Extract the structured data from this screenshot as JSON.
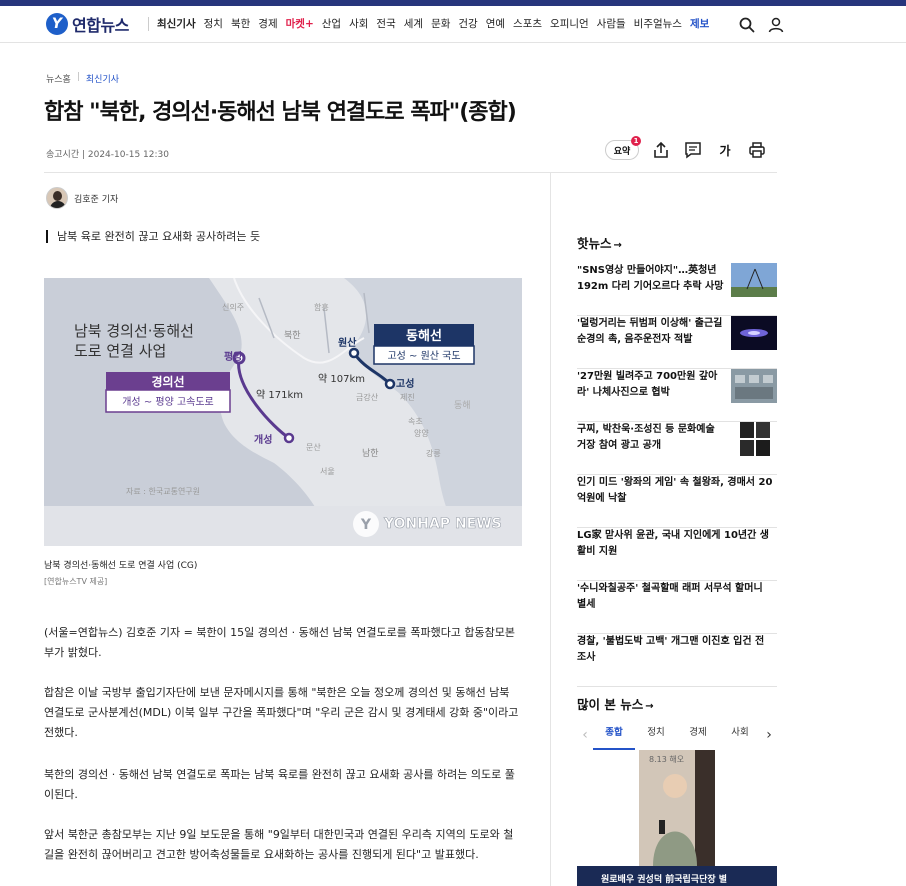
{
  "header": {
    "logo_text": "연합뉴스",
    "nav": [
      {
        "label": "최신기사",
        "style": "bold"
      },
      {
        "label": "정치",
        "style": ""
      },
      {
        "label": "북한",
        "style": ""
      },
      {
        "label": "경제",
        "style": ""
      },
      {
        "label": "마켓+",
        "style": "red"
      },
      {
        "label": "산업",
        "style": ""
      },
      {
        "label": "사회",
        "style": ""
      },
      {
        "label": "전국",
        "style": ""
      },
      {
        "label": "세계",
        "style": ""
      },
      {
        "label": "문화",
        "style": ""
      },
      {
        "label": "건강",
        "style": ""
      },
      {
        "label": "연예",
        "style": ""
      },
      {
        "label": "스포츠",
        "style": ""
      },
      {
        "label": "오피니언",
        "style": ""
      },
      {
        "label": "사람들",
        "style": ""
      },
      {
        "label": "비주얼뉴스",
        "style": ""
      },
      {
        "label": "제보",
        "style": "blue"
      }
    ],
    "icons": [
      "search-icon",
      "user-icon"
    ]
  },
  "breadcrumb": {
    "home": "뉴스홈",
    "current": "최신기사"
  },
  "article": {
    "title": "합참 \"북한, 경의선·동해선 남북 연결도로 폭파\"(종합)",
    "meta": "송고시간 | 2024-10-15 12:30",
    "summary_label": "요약",
    "summary_badge": "1",
    "font_size_label": "가",
    "author": "김호준 기자",
    "subhead": "남북 육로 완전히 끊고 요새화 공사하려는 듯",
    "photo": {
      "title_line1": "남북 경의선·동해선",
      "title_line2": "도로 연결 사업",
      "west_name": "경의선",
      "west_route": "개성 ~ 평양 고속도로",
      "east_name": "동해선",
      "east_route": "고성 ~ 원산 국도",
      "dist_west": "약 171km",
      "dist_east": "약 107km",
      "city_pyongyang": "평양",
      "city_kaesong": "개성",
      "city_wonsan": "원산",
      "city_goseong": "고성",
      "label_north": "북한",
      "label_south": "남한",
      "label_sinuiju": "신의주",
      "label_hamheung": "함흥",
      "label_geumgang": "금강산",
      "label_gangneung": "강릉",
      "label_east_sea": "동해",
      "label_munsan": "문산",
      "label_seoul": "서울",
      "label_jejin": "제진",
      "label_sokcho": "속초",
      "label_yangyang": "양양",
      "source": "자료 : 한국교통연구원",
      "watermark": "YONHAP NEWS"
    },
    "caption": "남북 경의선·동해선 도로 연결 사업 (CG)",
    "caption_src": "[연합뉴스TV 제공]",
    "paragraphs": [
      "(서울=연합뉴스) 김호준 기자 = 북한이 15일 경의선 · 동해선 남북 연결도로를 폭파했다고 합동참모본부가 밝혔다.",
      "합참은 이날 국방부 출입기자단에 보낸 문자메시지를 통해 \"북한은 오늘 정오께 경의선 및 동해선 남북 연결도로 군사분계선(MDL) 이북 일부 구간을 폭파했다\"며 \"우리 군은 감시 및 경계태세 강화 중\"이라고 전했다.",
      "북한의 경의선 · 동해선 남북 연결도로 폭파는 남북 육로를 완전히 끊고 요새화 공사를 하려는 의도로 풀이된다.",
      "앞서 북한군 총참모부는 지난 9일 보도문을 통해 \"9일부터 대한민국과 연결된 우리측 지역의 도로와 철길을 완전히 끊어버리고 견고한 방어축성물들로 요새화하는 공사를 진행되게 된다\"고 발표했다."
    ]
  },
  "sidebar": {
    "hot_title": "핫뉴스",
    "hot_items": [
      "\"SNS영상 만들어야지\"…英청년 192m 다리 기어오르다 추락 사망",
      "'덜렁거리는 뒤범퍼 이상해' 출근길 순경의 촉, 음주운전자 적발",
      "'27만원 빌려주고 700만원 갚아라' 나체사진으로 협박",
      "구찌, 박찬욱·조성진 등 문화예술 거장 참여 광고 공개",
      "인기 미드 '왕좌의 게임' 속 철왕좌, 경매서 20억원에 낙찰",
      "LG家 맏사위 윤관, 국내 지인에게 10년간 생활비 지원",
      "'수니와칠공주' 철곡할매 래퍼 서무석 할머니 별세",
      "경찰, '불법도박 고백' 개그맨 이진호 입건 전 조사"
    ],
    "popular_title": "많이 본 뉴스",
    "tabs": [
      "종합",
      "정치",
      "경제",
      "사회"
    ],
    "popular_img_text": "8.13 해오",
    "popular_headline": "원로배우 권성덕 前국립극단장 별"
  }
}
